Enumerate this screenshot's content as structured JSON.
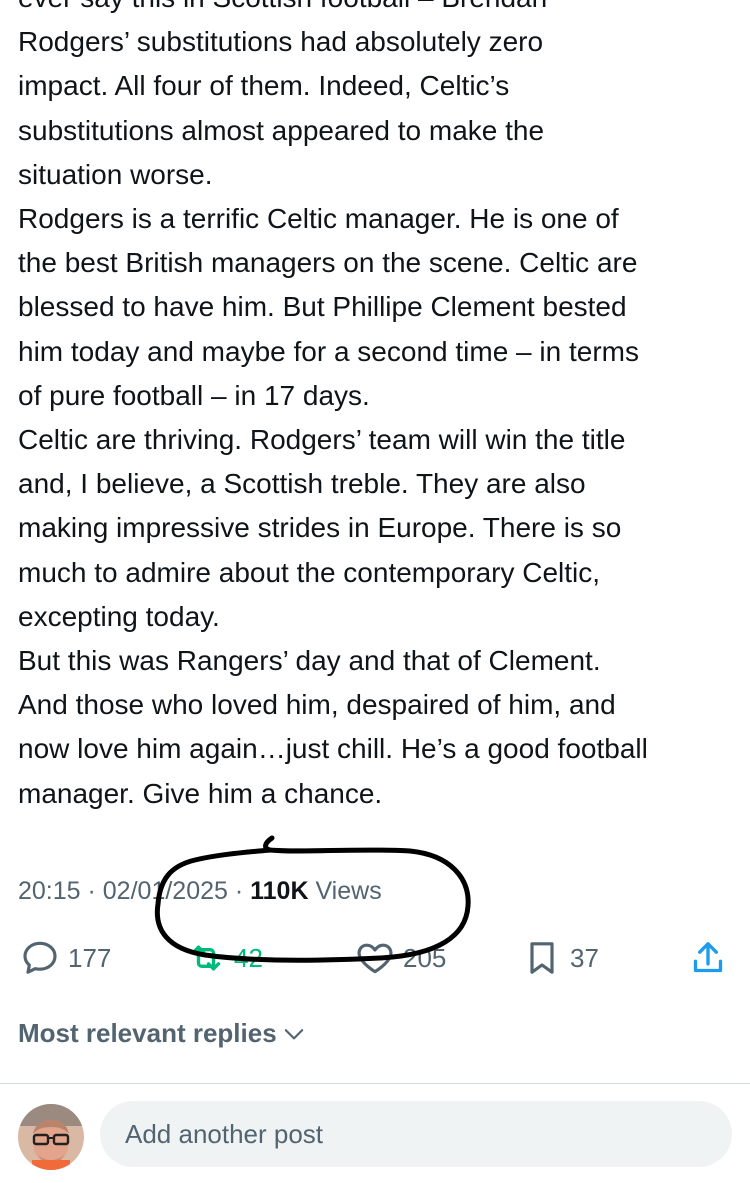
{
  "post": {
    "lines": [
      "ever say this in Scottish football – Brendan",
      "Rodgers’ substitutions had absolutely zero",
      "impact. All four of them. Indeed, Celtic’s",
      "substitutions almost appeared to make the",
      "situation worse.",
      "Rodgers is a terrific Celtic manager. He is one of",
      "the best British managers on the scene. Celtic are",
      "blessed to have him. But Phillipe Clement bested",
      "him today and maybe for a second time – in terms",
      "of pure football – in 17 days.",
      "Celtic are thriving. Rodgers’ team will win the title",
      "and, I believe, a Scottish treble. They are also",
      "making impressive strides in Europe. There is so",
      "much to admire about the contemporary Celtic,",
      "excepting today.",
      "But this was Rangers’ day and that of Clement.",
      "And those who loved him, despaired of him, and",
      "now love him again…just chill. He’s a good football",
      "manager. Give him a chance."
    ]
  },
  "meta": {
    "time": "20:15",
    "separator": " · ",
    "date": "02/01/2025",
    "views_count": "110K",
    "views_label": " Views"
  },
  "actions": {
    "replies": "177",
    "reposts": "42",
    "likes": "205",
    "bookmarks": "37"
  },
  "replies_section": {
    "label": "Most relevant replies"
  },
  "composer": {
    "placeholder": "Add another post"
  },
  "icons": {
    "reply": "reply-icon",
    "repost": "repost-icon",
    "like": "heart-icon",
    "bookmark": "bookmark-icon",
    "share": "share-icon",
    "chevron": "chevron-down-icon"
  },
  "colors": {
    "text": "#0f1419",
    "secondary": "#536471",
    "repost_green": "#00ba7c",
    "compose_bg": "#eff3f4",
    "annotation": "#000000"
  }
}
